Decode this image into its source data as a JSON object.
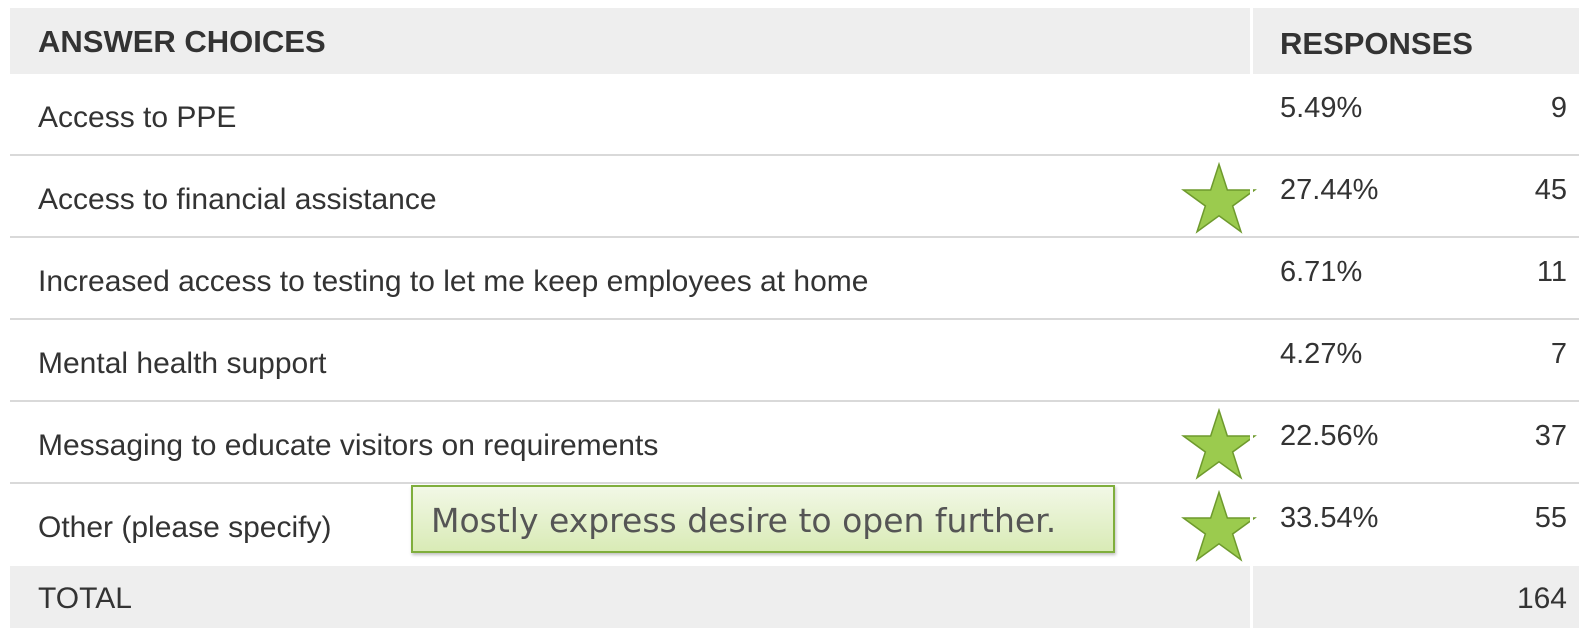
{
  "chart_data": {
    "type": "table",
    "columns": [
      "ANSWER CHOICES",
      "RESPONSES"
    ],
    "rows": [
      {
        "answer": "Access to PPE",
        "percent": "5.49%",
        "count": "9",
        "starred": false
      },
      {
        "answer": "Access to financial assistance",
        "percent": "27.44%",
        "count": "45",
        "starred": true
      },
      {
        "answer": "Increased access to testing to let me keep employees at home",
        "percent": "6.71%",
        "count": "11",
        "starred": false
      },
      {
        "answer": "Mental health support",
        "percent": "4.27%",
        "count": "7",
        "starred": false
      },
      {
        "answer": "Messaging to educate visitors on requirements",
        "percent": "22.56%",
        "count": "37",
        "starred": true
      },
      {
        "answer": "Other (please specify)",
        "percent": "33.54%",
        "count": "55",
        "starred": true
      }
    ],
    "total_label": "TOTAL",
    "total_count": "164",
    "annotation": "Mostly express desire to open further."
  },
  "colors": {
    "header_bg": "#eeeeee",
    "star_fill": "#9bcb4e",
    "star_stroke": "#6e9a2d",
    "callout_border": "#7fae3c"
  },
  "icons": {
    "highlight": "star-icon"
  }
}
